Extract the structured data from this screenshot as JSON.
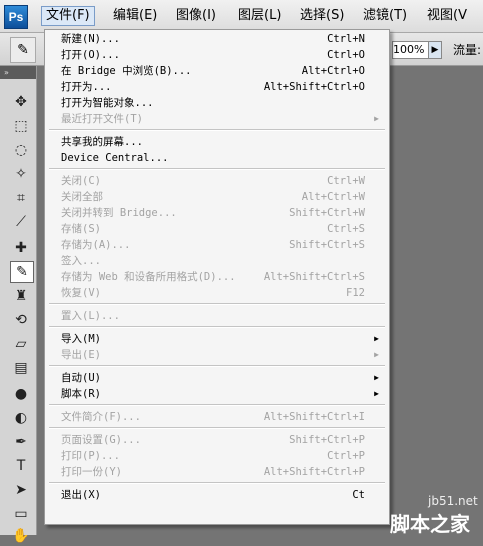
{
  "app": {
    "logo": "Ps"
  },
  "menubar": {
    "items": [
      {
        "label": "文件(F)",
        "open": true
      },
      {
        "label": "编辑(E)"
      },
      {
        "label": "图像(I)"
      },
      {
        "label": "图层(L)"
      },
      {
        "label": "选择(S)"
      },
      {
        "label": "滤镜(T)"
      },
      {
        "label": "视图(V"
      }
    ]
  },
  "optionsbar": {
    "brush_icon": "brush-icon",
    "opacity": "100%",
    "flow_label": "流量:"
  },
  "toolbar": {
    "icons": [
      "move-icon",
      "marquee-icon",
      "lasso-icon",
      "magic-wand-icon",
      "crop-icon",
      "eyedropper-icon",
      "healing-brush-icon",
      "brush-icon",
      "clone-stamp-icon",
      "history-brush-icon",
      "eraser-icon",
      "gradient-icon",
      "blur-icon",
      "dodge-icon",
      "pen-icon",
      "type-icon",
      "path-select-icon",
      "shape-icon",
      "hand-icon"
    ]
  },
  "file_menu": {
    "groups": [
      [
        {
          "label": "新建(N)...",
          "shortcut": "Ctrl+N"
        },
        {
          "label": "打开(O)...",
          "shortcut": "Ctrl+O"
        },
        {
          "label": "在 Bridge 中浏览(B)...",
          "shortcut": "Alt+Ctrl+O"
        },
        {
          "label": "打开为...",
          "shortcut": "Alt+Shift+Ctrl+O"
        },
        {
          "label": "打开为智能对象..."
        },
        {
          "label": "最近打开文件(T)",
          "disabled": true,
          "submenu": true
        }
      ],
      [
        {
          "label": "共享我的屏幕..."
        },
        {
          "label": "Device Central..."
        }
      ],
      [
        {
          "label": "关闭(C)",
          "shortcut": "Ctrl+W",
          "disabled": true
        },
        {
          "label": "关闭全部",
          "shortcut": "Alt+Ctrl+W",
          "disabled": true
        },
        {
          "label": "关闭并转到 Bridge...",
          "shortcut": "Shift+Ctrl+W",
          "disabled": true
        },
        {
          "label": "存储(S)",
          "shortcut": "Ctrl+S",
          "disabled": true
        },
        {
          "label": "存储为(A)...",
          "shortcut": "Shift+Ctrl+S",
          "disabled": true
        },
        {
          "label": "签入...",
          "disabled": true
        },
        {
          "label": "存储为 Web 和设备所用格式(D)...",
          "shortcut": "Alt+Shift+Ctrl+S",
          "disabled": true
        },
        {
          "label": "恢复(V)",
          "shortcut": "F12",
          "disabled": true
        }
      ],
      [
        {
          "label": "置入(L)...",
          "disabled": true
        }
      ],
      [
        {
          "label": "导入(M)",
          "submenu": true
        },
        {
          "label": "导出(E)",
          "disabled": true,
          "submenu": true
        }
      ],
      [
        {
          "label": "自动(U)",
          "submenu": true
        },
        {
          "label": "脚本(R)",
          "submenu": true
        }
      ],
      [
        {
          "label": "文件简介(F)...",
          "shortcut": "Alt+Shift+Ctrl+I",
          "disabled": true
        }
      ],
      [
        {
          "label": "页面设置(G)...",
          "shortcut": "Shift+Ctrl+P",
          "disabled": true
        },
        {
          "label": "打印(P)...",
          "shortcut": "Ctrl+P",
          "disabled": true
        },
        {
          "label": "打印一份(Y)",
          "shortcut": "Alt+Shift+Ctrl+P",
          "disabled": true
        }
      ],
      [
        {
          "label": "退出(X)",
          "shortcut": "Ct"
        }
      ]
    ]
  },
  "watermark": {
    "url": "jb51.net",
    "name": "脚本之家"
  }
}
